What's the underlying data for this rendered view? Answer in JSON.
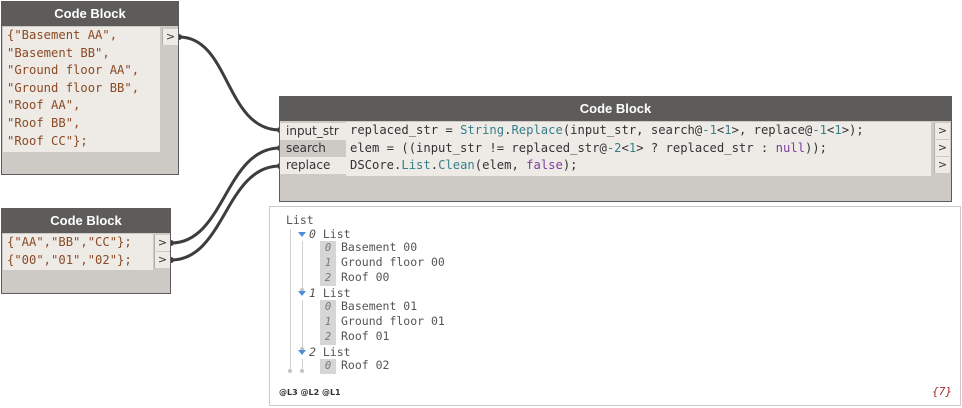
{
  "node1": {
    "title": "Code Block",
    "lines": [
      "{\"Basement AA\",",
      "\"Basement BB\",",
      "\"Ground floor AA\",",
      "\"Ground floor BB\",",
      "\"Roof AA\",",
      "\"Roof BB\",",
      "\"Roof CC\"};"
    ],
    "output_glyph": ">"
  },
  "node2": {
    "title": "Code Block",
    "lines": [
      "{\"AA\",\"BB\",\"CC\"};",
      "{\"00\",\"01\",\"02\"};"
    ],
    "output_glyphs": [
      ">",
      ">"
    ]
  },
  "node3": {
    "title": "Code Block",
    "inputs": [
      "input_str",
      "search",
      "replace"
    ],
    "line1": {
      "a": "replaced_str = ",
      "b": "String",
      "c": ".",
      "d": "Replace",
      "e": "(input_str, search@",
      "f": "-1",
      "g": "<",
      "h": "1",
      "i": ">, replace@",
      "j": "-1",
      "k": "<",
      "l": "1",
      "m": ">);"
    },
    "line2": {
      "a": "elem = ((input_str != replaced_str@",
      "b": "-2",
      "c": "<",
      "d": "1",
      "e": "> ? replaced_str : ",
      "f": "null",
      "g": "));"
    },
    "line3": {
      "a": "DSCore",
      "b": ".",
      "c": "List",
      "d": ".",
      "e": "Clean",
      "f": "(elem, ",
      "g": "false",
      "h": ");"
    },
    "output_glyphs": [
      ">",
      ">",
      ">"
    ]
  },
  "preview": {
    "root_label": "List",
    "groups": [
      {
        "index": "0",
        "label": "List",
        "items": [
          {
            "index": "0",
            "value": "Basement 00"
          },
          {
            "index": "1",
            "value": "Ground floor 00"
          },
          {
            "index": "2",
            "value": "Roof 00"
          }
        ]
      },
      {
        "index": "1",
        "label": "List",
        "items": [
          {
            "index": "0",
            "value": "Basement 01"
          },
          {
            "index": "1",
            "value": "Ground floor 01"
          },
          {
            "index": "2",
            "value": "Roof 01"
          }
        ]
      },
      {
        "index": "2",
        "label": "List",
        "items": [
          {
            "index": "0",
            "value": "Roof 02"
          }
        ]
      }
    ],
    "levels": [
      "@L3",
      "@L2",
      "@L1"
    ],
    "count": "{7}"
  },
  "colors": {
    "node_header": "#5e5c5a",
    "node_body": "#cdc9c4",
    "code_bg": "#eeebe7",
    "string_text": "#8a4a24",
    "function_text": "#367e8a",
    "keyword_text": "#7d3e9e",
    "wire": "#3d3d3d",
    "count_text": "#a02828",
    "expander": "#4a90d9"
  }
}
